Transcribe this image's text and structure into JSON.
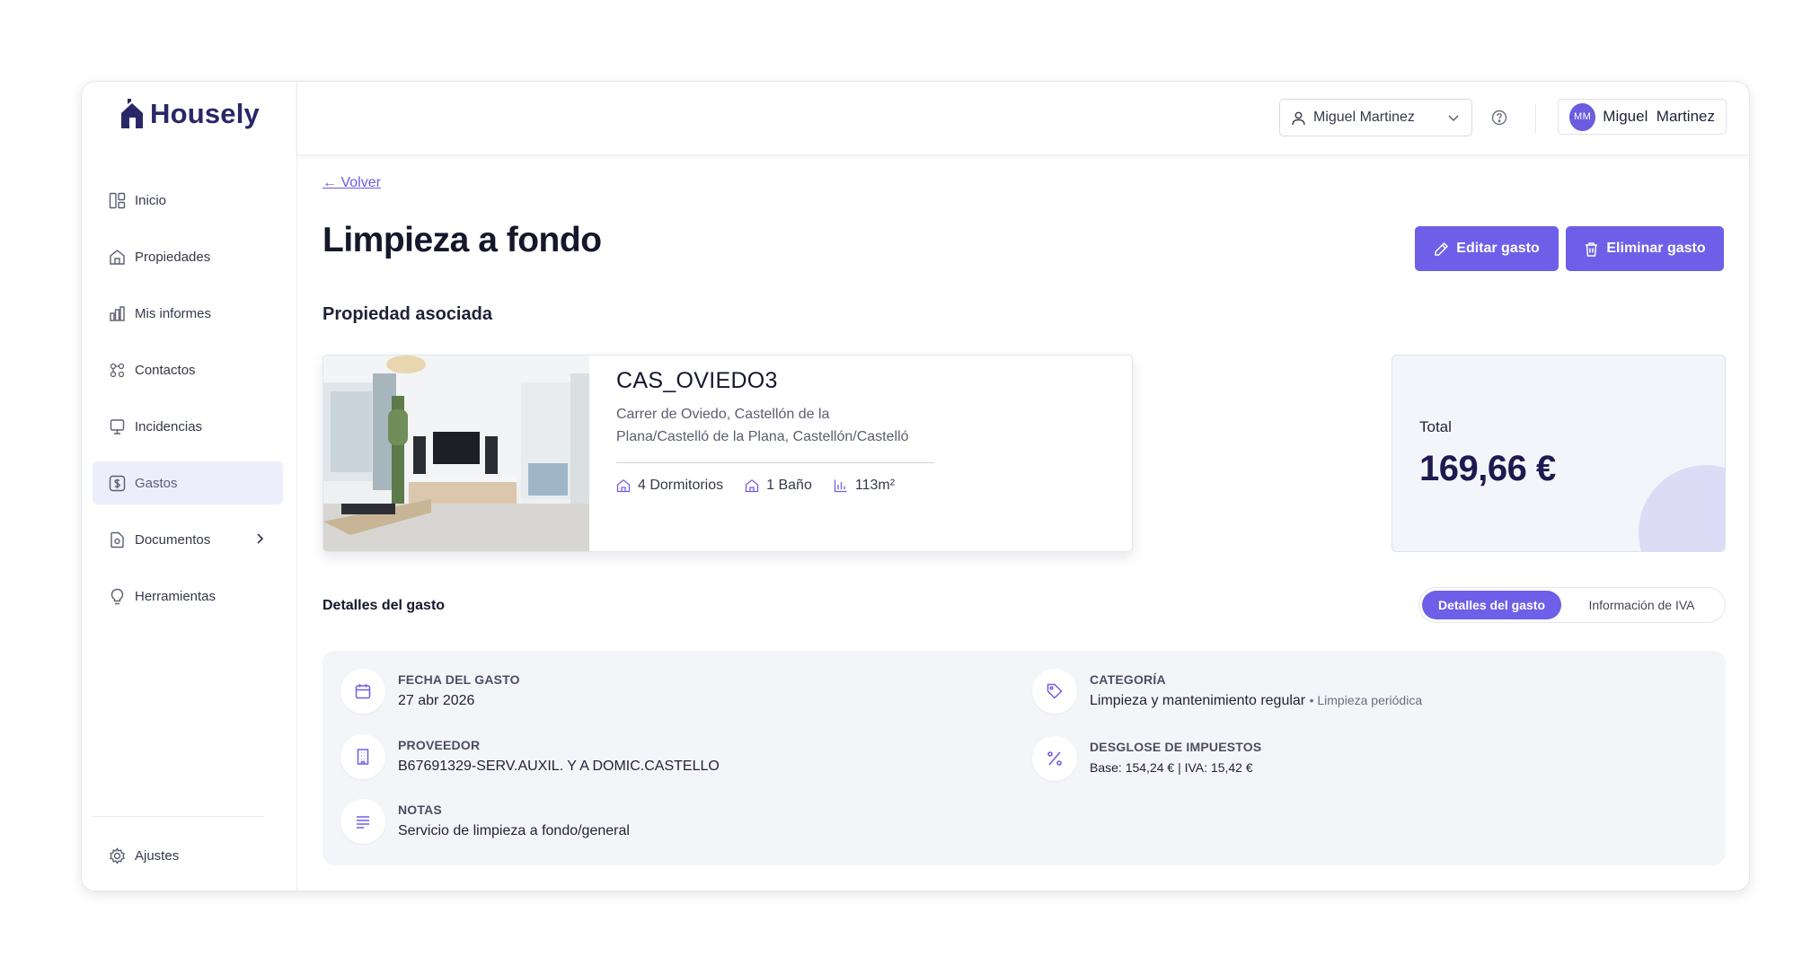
{
  "brand": {
    "name": "Housely",
    "color": "#2a2768",
    "accent": "#6e5fe8"
  },
  "sidebar": {
    "items": [
      {
        "label": "Inicio",
        "icon": "dashboard-icon"
      },
      {
        "label": "Propiedades",
        "icon": "home-icon"
      },
      {
        "label": "Mis informes",
        "icon": "bar-chart-icon"
      },
      {
        "label": "Contactos",
        "icon": "contacts-icon"
      },
      {
        "label": "Incidencias",
        "icon": "monitor-icon"
      },
      {
        "label": "Gastos",
        "icon": "dollar-icon",
        "active": true
      },
      {
        "label": "Documentos",
        "icon": "document-icon",
        "has_submenu": true
      },
      {
        "label": "Herramientas",
        "icon": "lightbulb-icon"
      }
    ],
    "settings_label": "Ajustes"
  },
  "header": {
    "user_select_value": "Miguel Martinez",
    "profile_initials": "MM",
    "profile_name": "Miguel  Martinez"
  },
  "main": {
    "back_label": "← Volver",
    "title": "Limpieza a fondo",
    "edit_label": "Editar gasto",
    "delete_label": "Eliminar gasto",
    "assoc_heading": "Propiedad asociada",
    "property": {
      "code": "CAS_OVIEDO3",
      "address_line1": "Carrer de Oviedo, Castellón de la",
      "address_line2": "Plana/Castelló de la Plana, Castellón/Castelló",
      "bedrooms": "4 Dormitorios",
      "bathrooms": "1 Baño",
      "area": "113m²"
    },
    "total": {
      "label": "Total",
      "value": "169,66 €"
    },
    "details_heading": "Detalles del gasto",
    "tabs": [
      {
        "label": "Detalles del gasto",
        "active": true
      },
      {
        "label": "Información de IVA",
        "active": false
      }
    ],
    "details": {
      "fecha": {
        "label": "FECHA DEL GASTO",
        "value": "27 abr 2026"
      },
      "proveedor": {
        "label": "PROVEEDOR",
        "value": "B67691329-SERV.AUXIL. Y A DOMIC.CASTELLO"
      },
      "notas": {
        "label": "NOTAS",
        "value": "Servicio de limpieza a fondo/general"
      },
      "categoria": {
        "label": "CATEGORÍA",
        "value": "Limpieza y mantenimiento regular",
        "sub": "• Limpieza periódica"
      },
      "impuestos": {
        "label": "DESGLOSE DE IMPUESTOS",
        "value": "Base: 154,24 € | IVA: 15,42 €"
      }
    }
  }
}
